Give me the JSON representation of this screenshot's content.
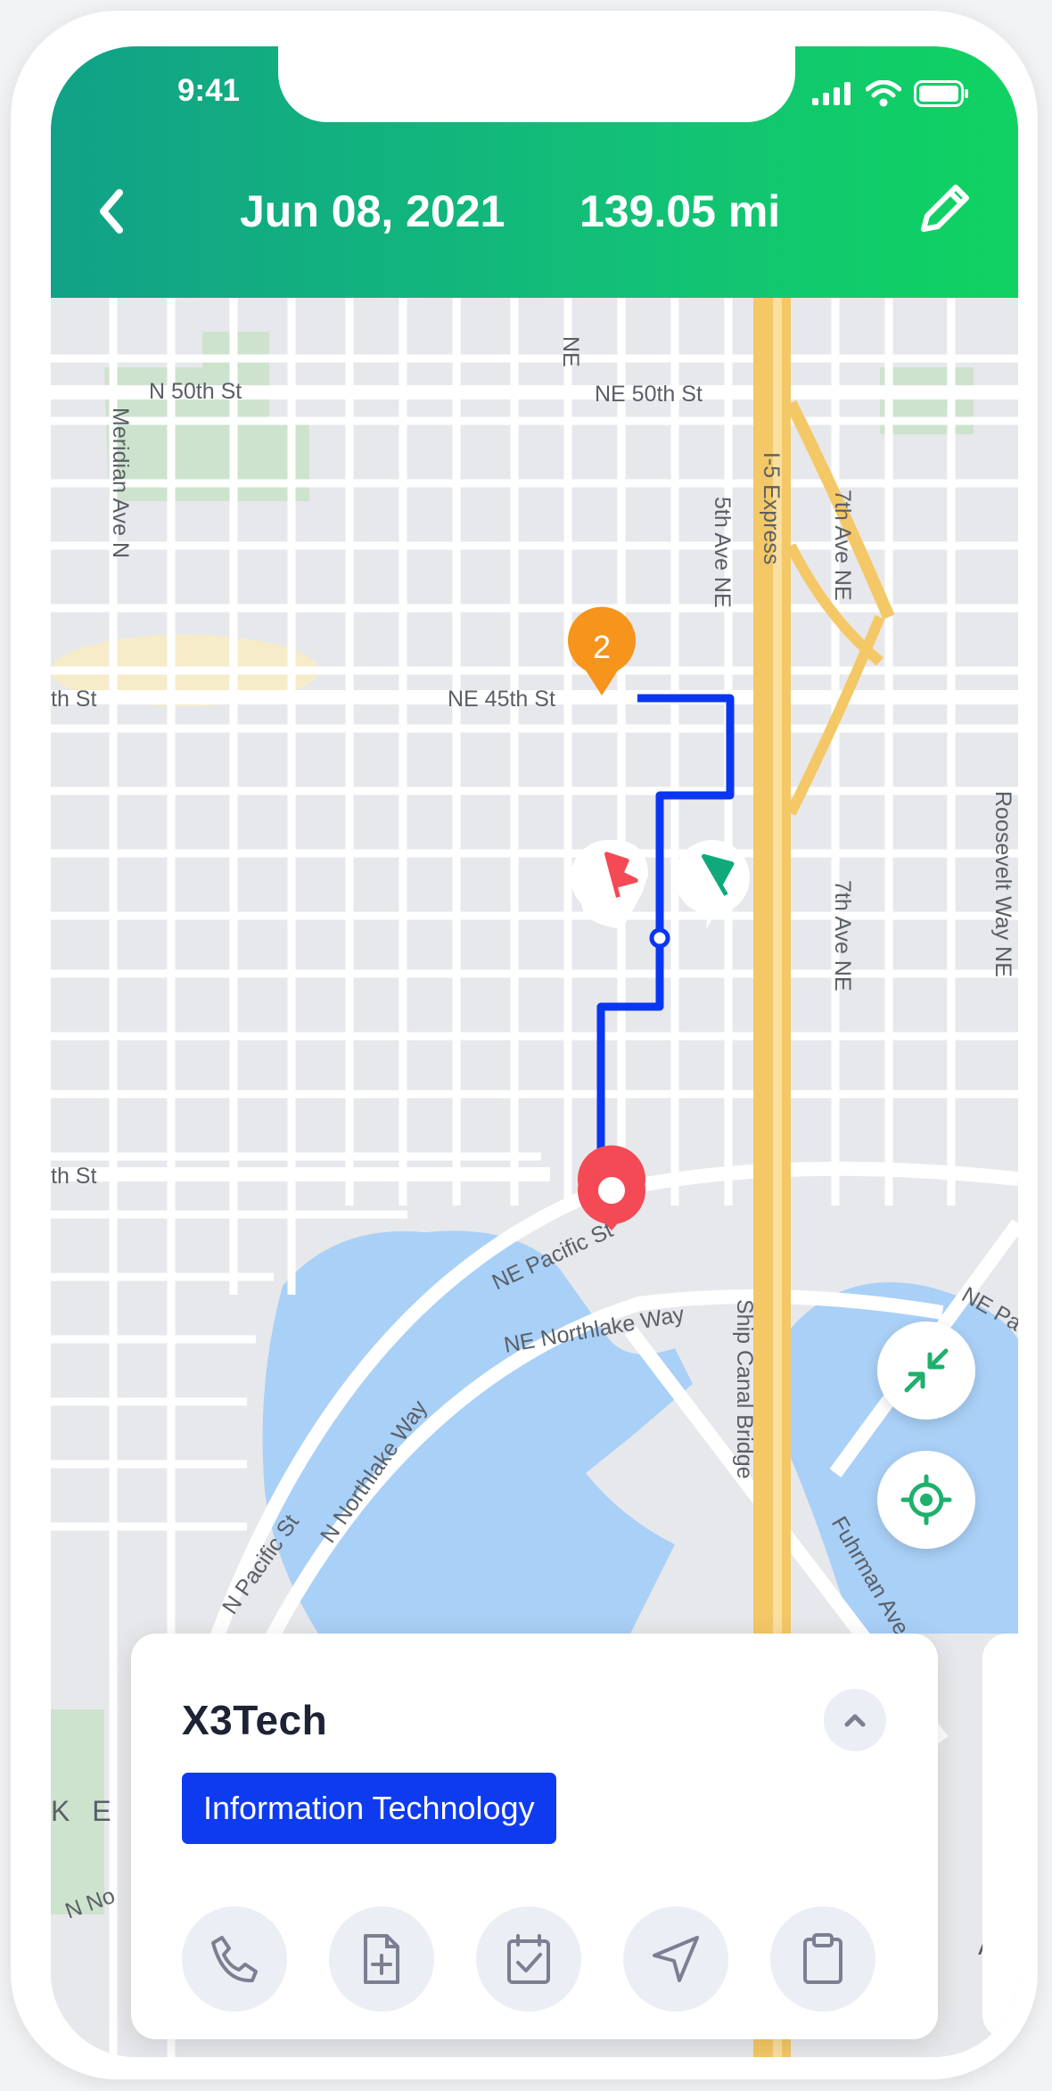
{
  "status_bar": {
    "time": "9:41"
  },
  "header": {
    "date": "Jun 08, 2021",
    "distance": "139.05 mi",
    "gradient": [
      "#11a187",
      "#0fd361"
    ]
  },
  "map": {
    "route_color": "#0a36f2",
    "waypoint_badge": "2",
    "streets": [
      "N 50th St",
      "NE 50th St",
      "Meridian Ave N",
      "NE",
      "5th Ave NE",
      "I-5 Express",
      "7th Ave NE",
      "th St",
      "NE 45th St",
      "7th Ave NE",
      "Roosevelt Way NE",
      "th St",
      "NE Pacific St",
      "NE Northlake Way",
      "Ship Canal Bridge",
      "NE Pa",
      "N Northlake Way",
      "N Pacific St",
      "Fuhrman Ave",
      "K E",
      "N No",
      "A Y"
    ]
  },
  "controls": {
    "collapse_icon": "arrows-collapse-icon",
    "locate_icon": "crosshair-icon"
  },
  "card": {
    "company": "X3Tech",
    "category": "Information Technology",
    "category_color": "#0f3bf0",
    "actions": [
      "phone-icon",
      "add-file-icon",
      "checklist-icon",
      "navigate-icon",
      "clipboard-icon"
    ]
  }
}
